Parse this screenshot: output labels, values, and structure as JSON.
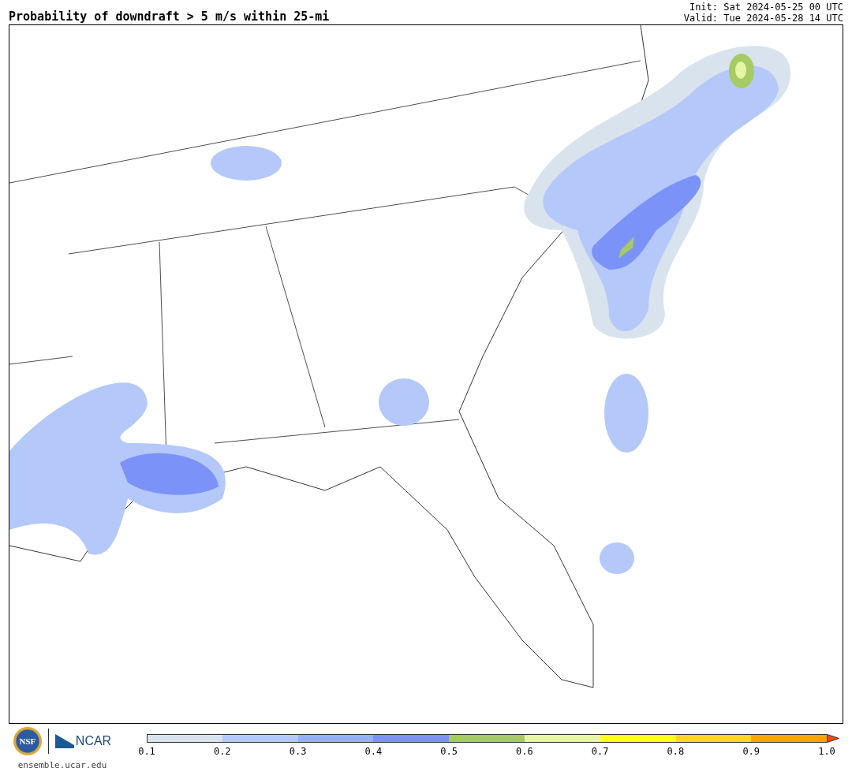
{
  "title": "Probability of downdraft > 5 m/s within 25-mi",
  "init": "Init: Sat 2024-05-25 00 UTC",
  "valid": "Valid: Tue 2024-05-28 14 UTC",
  "logos": {
    "nsf": "NSF",
    "ncar": "NCAR",
    "url": "ensemble.ucar.edu"
  },
  "colorbar": {
    "segments": [
      {
        "color": "#d8e3ee"
      },
      {
        "color": "#b4c8fa"
      },
      {
        "color": "#95b1fb"
      },
      {
        "color": "#7b93f8"
      },
      {
        "color": "#a5cb62"
      },
      {
        "color": "#e6f5a6"
      },
      {
        "color": "#ffff1c"
      },
      {
        "color": "#ffd52c"
      },
      {
        "color": "#ffa405"
      }
    ],
    "extend": {
      "color": "#f24a06"
    },
    "ticks": [
      "0.1",
      "0.2",
      "0.3",
      "0.4",
      "0.5",
      "0.6",
      "0.7",
      "0.8",
      "0.9",
      "1.0"
    ]
  }
}
